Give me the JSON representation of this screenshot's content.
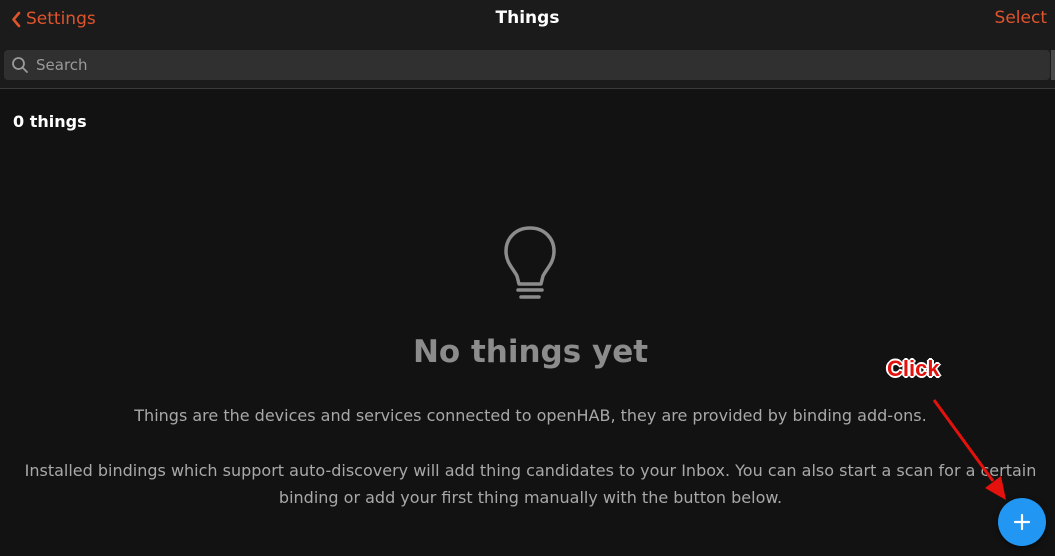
{
  "navbar": {
    "back_label": "Settings",
    "title": "Things",
    "select_label": "Select"
  },
  "search": {
    "placeholder": "Search"
  },
  "list": {
    "count_label": "0 things"
  },
  "empty_state": {
    "icon": "lightbulb-icon",
    "title": "No things yet",
    "description": "Things are the devices and services connected to openHAB, they are provided by binding add-ons.",
    "description2": "Installed bindings which support auto-discovery will add thing candidates to your Inbox. You can also start a scan for a certain binding or add your first thing manually with the button below."
  },
  "fab": {
    "icon": "plus-icon"
  },
  "annotation": {
    "label": "Click"
  },
  "colors": {
    "background": "#121212",
    "navbar": "#1b1b1b",
    "accent": "#e0542c",
    "fab": "#2196f3",
    "annotation": "#e4110c"
  }
}
